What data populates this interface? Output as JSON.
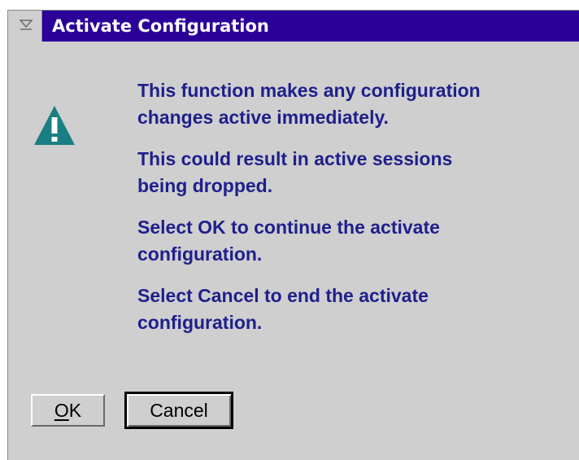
{
  "window": {
    "title": "Activate Configuration",
    "system_menu_icon": "system-menu-icon"
  },
  "icon": {
    "name": "warning-icon",
    "color": "#1a7f82"
  },
  "message": {
    "paragraphs": [
      "This function makes any configuration\nchanges active immediately.",
      "This could result in active sessions\nbeing dropped.",
      "Select OK to continue the activate\nconfiguration.",
      "Select Cancel to end the activate\nconfiguration."
    ]
  },
  "buttons": {
    "ok_mnemonic": "O",
    "ok_rest": "K",
    "cancel_label": "Cancel"
  },
  "colors": {
    "titlebar": "#2a0099",
    "dialog_background": "#cfcfcf",
    "message_text": "#1f1f8c"
  }
}
